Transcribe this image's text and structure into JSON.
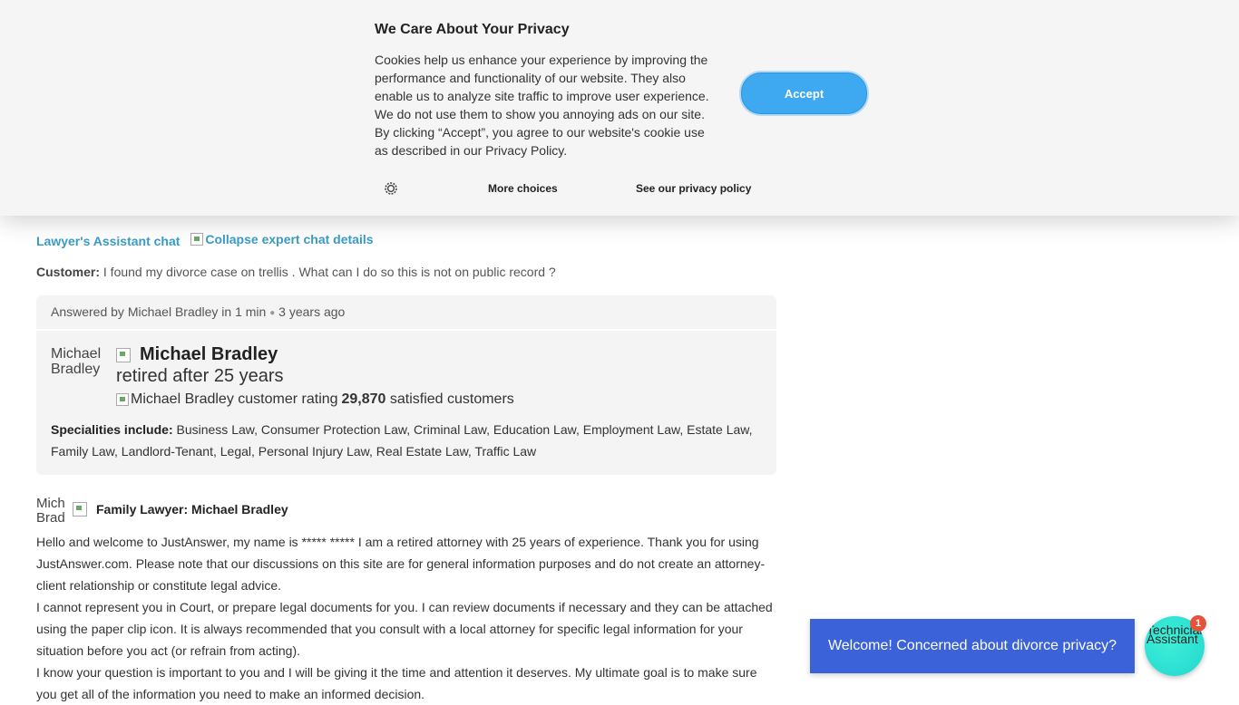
{
  "cookie_banner": {
    "title": "We Care About Your Privacy",
    "body": "Cookies help us enhance your experience by improving the performance and functionality of our website. They also enable us to analyze site traffic to improve user experience. We do not use them to show you annoying ads on our site. By clicking “Accept”, you agree to our website's cookie use as described in our Privacy Policy.",
    "accept_label": "Accept",
    "more_choices_label": "More choices",
    "privacy_policy_label": "See our privacy policy",
    "accent_color": "#3ea8f0"
  },
  "chat": {
    "header_title": "Lawyer's Assistant chat",
    "collapse_alt": "Collapse expert chat details",
    "customer_label": "Customer:",
    "customer_question": "I found my divorce case on trellis . What can I do so this is not on public record ?"
  },
  "answer": {
    "answered_by": "Answered by Michael Bradley in 1 min",
    "time_ago": "3 years ago",
    "avatar_alt": "Michael Bradley",
    "expert_name": "Michael Bradley",
    "expert_subtitle": "retired after 25 years",
    "rating_alt": "Michael Bradley customer rating",
    "satisfied_count": "29,870",
    "satisfied_label": "satisfied customers",
    "specialities_label": "Specialities include:",
    "specialities": "Business Law, Consumer Protection Law, Criminal Law, Education Law, Employment Law, Estate Law, Family Law, Landlord-Tenant, Legal, Personal Injury Law, Real Estate Law, Traffic Law"
  },
  "message": {
    "avatar_alt": "Michael Bradley",
    "title": "Family Lawyer: Michael Bradley",
    "paragraphs": [
      "Hello and welcome to JustAnswer, my name is ***** ***** I am a retired attorney with 25 years of experience. Thank you for using JustAnswer.com. Please note that our discussions on this site are for general information purposes and do not create an attorney-client relationship or constitute legal advice.",
      "I cannot represent you in Court, or prepare legal documents for you. I can review documents if necessary and they can be attached using the paper clip icon. It is always recommended that you consult with a local attorney for specific legal information for your situation before you act (or refrain from acting).",
      "I know your question is important to you and I will be giving it the time and attention it deserves. My ultimate goal is to make sure you get all of the information you need to make an informed decision."
    ]
  },
  "chat_widget": {
    "welcome_text": "Welcome! Concerned about divorce privacy?",
    "assistant_label": "Technician Assistant",
    "badge_count": "1",
    "welcome_color": "#3b62d8",
    "bubble_color": "#20d6cf",
    "badge_color": "#e5533d"
  }
}
